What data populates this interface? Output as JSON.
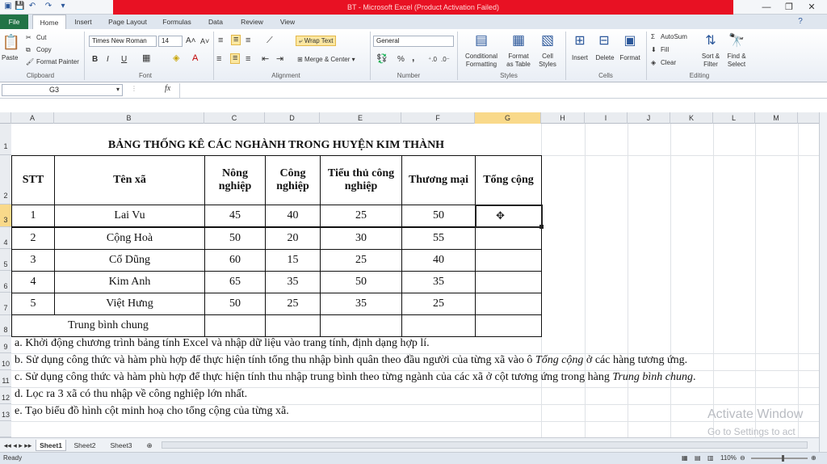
{
  "window": {
    "title": "BT - Microsoft Excel (Product Activation Failed)",
    "controls": [
      "—",
      "❐",
      "✕"
    ]
  },
  "tabs": [
    "File",
    "Home",
    "Insert",
    "Page Layout",
    "Formulas",
    "Data",
    "Review",
    "View"
  ],
  "ribbon": {
    "clipboard": {
      "paste": "Paste",
      "cut": "Cut",
      "copy": "Copy",
      "format_painter": "Format Painter",
      "group": "Clipboard"
    },
    "font": {
      "name": "Times New Roman",
      "size": "14",
      "group": "Font",
      "bold": "B",
      "italic": "I",
      "underline": "U"
    },
    "alignment": {
      "wrap_text": "Wrap Text",
      "merge_center": "Merge & Center",
      "group": "Alignment"
    },
    "number": {
      "format": "General",
      "group": "Number",
      "percent": "%",
      "comma": ","
    },
    "styles": {
      "conditional": "Conditional\nFormatting",
      "format_table": "Format\nas Table",
      "cell_styles": "Cell\nStyles",
      "group": "Styles"
    },
    "cells": {
      "insert": "Insert",
      "delete": "Delete",
      "format": "Format",
      "group": "Cells"
    },
    "editing": {
      "autosum": "AutoSum",
      "fill": "Fill",
      "clear": "Clear",
      "sort_filter": "Sort &\nFilter",
      "find_select": "Find &\nSelect",
      "group": "Editing"
    }
  },
  "formula_bar": {
    "name_box": "G3",
    "fx": "fx",
    "value": ""
  },
  "columns": [
    "A",
    "B",
    "C",
    "D",
    "E",
    "F",
    "G",
    "H",
    "I",
    "J",
    "K",
    "L",
    "M"
  ],
  "rows": [
    "1",
    "2",
    "3",
    "4",
    "5",
    "6",
    "7",
    "8",
    "9",
    "10",
    "11",
    "12",
    "13"
  ],
  "sheet": {
    "title": "BẢNG THỐNG KÊ CÁC NGHÀNH TRONG HUYỆN KIM THÀNH",
    "headers": {
      "stt": "STT",
      "ten_xa": "Tên xã",
      "nong_nghiep": "Nông nghiệp",
      "cong_nghiep": "Công nghiệp",
      "tieu_thu": "Tiểu thủ công nghiệp",
      "thuong_mai": "Thương mại",
      "tong_cong": "Tổng cộng"
    },
    "rows": [
      {
        "stt": "1",
        "ten": "Lai Vu",
        "nn": "45",
        "cn": "40",
        "ttcn": "25",
        "tm": "50"
      },
      {
        "stt": "2",
        "ten": "Cộng Hoà",
        "nn": "50",
        "cn": "20",
        "ttcn": "30",
        "tm": "55"
      },
      {
        "stt": "3",
        "ten": "Cổ Dũng",
        "nn": "60",
        "cn": "15",
        "ttcn": "25",
        "tm": "40"
      },
      {
        "stt": "4",
        "ten": "Kim Anh",
        "nn": "65",
        "cn": "35",
        "ttcn": "50",
        "tm": "35"
      },
      {
        "stt": "5",
        "ten": "Việt Hưng",
        "nn": "50",
        "cn": "25",
        "ttcn": "35",
        "tm": "25"
      }
    ],
    "avg_label": "Trung bình chung",
    "notes": {
      "a": "a. Khởi động chương trình bảng tính Excel và nhập dữ liệu vào trang tính, định dạng hợp lí.",
      "b_pre": "b. Sử dụng công thức và hàm phù hợp để thực hiện tính tổng thu nhập bình quân theo đầu người của từng xã vào ô",
      "b_em": "Tổng cộng",
      "b_post": "ở các hàng tương ứng.",
      "c_pre": "c. Sử dụng công thức và hàm phù hợp để thực hiện tính thu nhập trung bình theo từng ngành của các xã ở cột tương ứng trong hàng",
      "c_em": "Trung bình chung",
      "c_post": ".",
      "d": "d. Lọc ra 3 xã có thu nhập về công nghiệp lớn nhất.",
      "e": "e. Tạo biểu đồ hình cột minh hoạ cho tổng cộng của từng xã."
    }
  },
  "sheet_tabs": [
    "Sheet1",
    "Sheet2",
    "Sheet3"
  ],
  "status": {
    "ready": "Ready",
    "zoom": "110%"
  },
  "watermark": {
    "line1": "Activate Window",
    "line2": "Go to Settings to act"
  }
}
